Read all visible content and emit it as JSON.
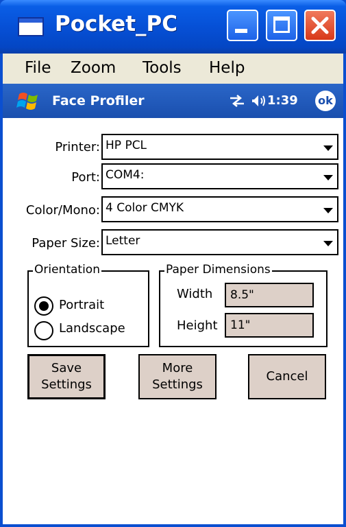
{
  "window": {
    "title": "Pocket_PC",
    "colors": {
      "titlebar": "#0650d6",
      "close_button": "#d8391a",
      "content": "#ffffff",
      "button_face": "#ddd0c8"
    }
  },
  "menu": {
    "items": [
      {
        "label": "File"
      },
      {
        "label": "Zoom"
      },
      {
        "label": "Tools"
      },
      {
        "label": "Help"
      }
    ]
  },
  "pda_bar": {
    "title": "Face Profiler",
    "time": "1:39",
    "ok_label": "ok",
    "icons": [
      "windows-start-icon",
      "connectivity-icon",
      "speaker-icon"
    ]
  },
  "form": {
    "printer": {
      "label": "Printer:",
      "value": "HP PCL"
    },
    "port": {
      "label": "Port:",
      "value": "COM4:"
    },
    "color_mono": {
      "label": "Color/Mono:",
      "value": "4 Color CMYK"
    },
    "paper_size": {
      "label": "Paper Size:",
      "value": "Letter"
    }
  },
  "orientation": {
    "legend": "Orientation",
    "options": [
      {
        "label": "Portrait",
        "selected": true
      },
      {
        "label": "Landscape",
        "selected": false
      }
    ]
  },
  "dimensions": {
    "legend": "Paper Dimensions",
    "width_label": "Width",
    "width_value": "8.5\"",
    "height_label": "Height",
    "height_value": "11\""
  },
  "buttons": {
    "save_line1": "Save",
    "save_line2": "Settings",
    "more_line1": "More",
    "more_line2": "Settings",
    "cancel": "Cancel"
  }
}
